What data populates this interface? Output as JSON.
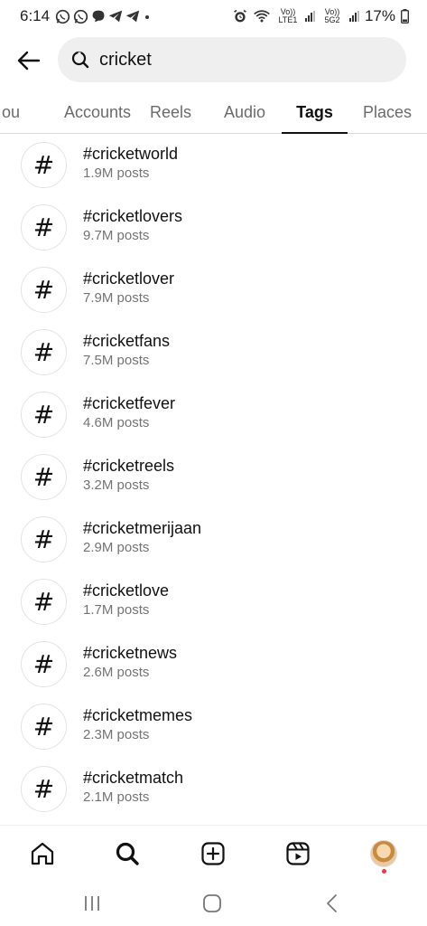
{
  "status_bar": {
    "time": "6:14",
    "battery": "17%",
    "network_1": "Vo)) LTE1",
    "network_2": "Vo)) 5G2",
    "icons": [
      "whatsapp-icon",
      "whatsapp-icon",
      "chat-icon",
      "telegram-icon",
      "telegram-icon",
      "dot-icon",
      "alarm-icon",
      "wifi-icon",
      "signal-icon",
      "signal-icon",
      "battery-icon"
    ]
  },
  "search": {
    "value": "cricket",
    "icons": [
      "back-arrow-icon",
      "search-icon"
    ]
  },
  "tabs": [
    {
      "label": "ou",
      "active": false
    },
    {
      "label": "Accounts",
      "active": false
    },
    {
      "label": "Reels",
      "active": false
    },
    {
      "label": "Audio",
      "active": false
    },
    {
      "label": "Tags",
      "active": true
    },
    {
      "label": "Places",
      "active": false
    }
  ],
  "tags": {
    "symbol": "#",
    "items": [
      {
        "name": "#cricketworld",
        "count": "1.9M posts"
      },
      {
        "name": "#cricketlovers",
        "count": "9.7M posts"
      },
      {
        "name": "#cricketlover",
        "count": "7.9M posts"
      },
      {
        "name": "#cricketfans",
        "count": "7.5M posts"
      },
      {
        "name": "#cricketfever",
        "count": "4.6M posts"
      },
      {
        "name": "#cricketreels",
        "count": "3.2M posts"
      },
      {
        "name": "#cricketmerijaan",
        "count": "2.9M posts"
      },
      {
        "name": "#cricketlove",
        "count": "1.7M posts"
      },
      {
        "name": "#cricketnews",
        "count": "2.6M posts"
      },
      {
        "name": "#cricketmemes",
        "count": "2.3M posts"
      },
      {
        "name": "#cricketmatch",
        "count": "2.1M posts"
      }
    ]
  },
  "bottom_nav": {
    "items": [
      "home-icon",
      "search-icon",
      "create-post-icon",
      "reels-icon",
      "profile-avatar"
    ],
    "notification_color": "#ff3040"
  },
  "system_nav": {
    "items": [
      "recent-apps-icon",
      "home-button-icon",
      "back-icon"
    ]
  },
  "colors": {
    "text": "#111111",
    "secondary_text": "#737373",
    "search_bg": "#efefef",
    "divider": "#dbdbdb"
  }
}
